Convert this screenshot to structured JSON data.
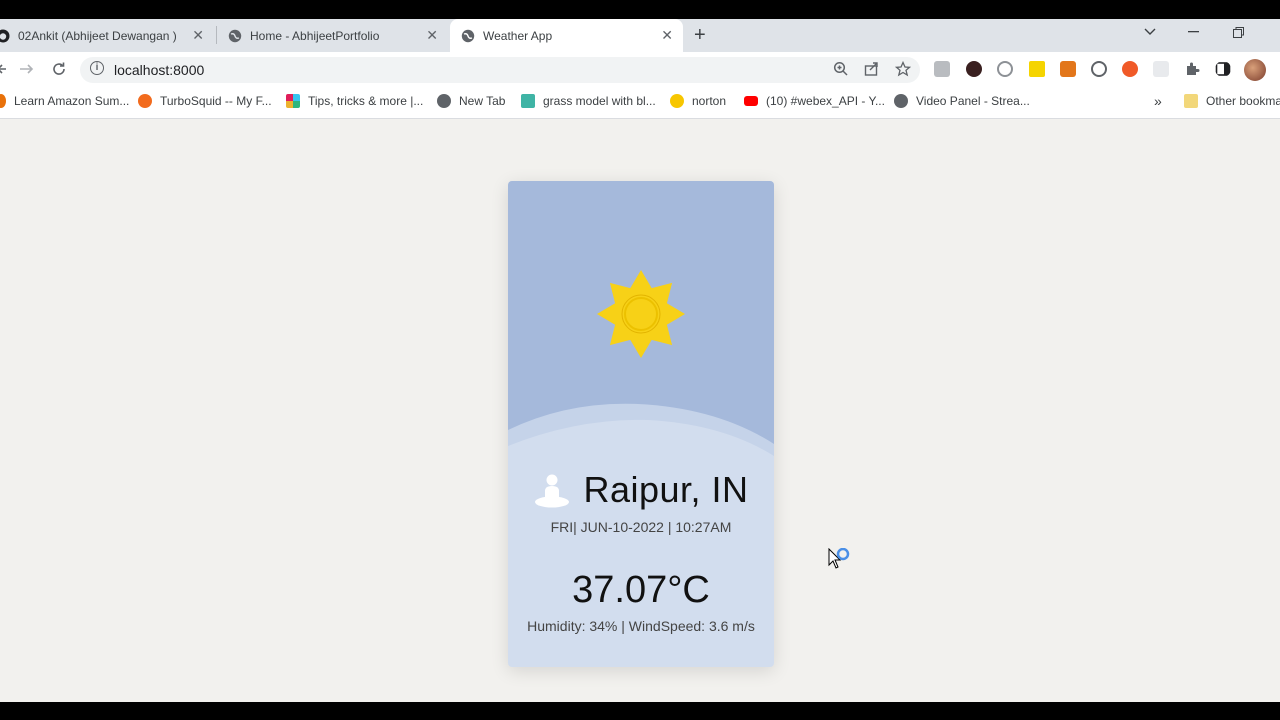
{
  "browser": {
    "tabs": [
      {
        "label": "02Ankit (Abhijeet Dewangan )",
        "icon": "github-icon",
        "active": false
      },
      {
        "label": "Home - AbhijeetPortfolio",
        "icon": "globe-icon",
        "active": false
      },
      {
        "label": "Weather App",
        "icon": "globe-icon",
        "active": true
      }
    ],
    "close_glyph": "✕",
    "new_tab_glyph": "+",
    "address": {
      "url": "localhost:8000",
      "info_glyph": "i"
    },
    "bookmarks": [
      {
        "label": "Learn Amazon Sum...",
        "icon": "amazon-icon",
        "color": "#e8710a"
      },
      {
        "label": "TurboSquid -- My F...",
        "icon": "turbosquid-icon",
        "color": "#f26b1d"
      },
      {
        "label": "Tips, tricks & more |...",
        "icon": "slack-icon",
        "color": "#611f69"
      },
      {
        "label": "New Tab",
        "icon": "globe-icon",
        "color": "#5f6368"
      },
      {
        "label": "grass model with bl...",
        "icon": "cgtrader-icon",
        "color": "#3fb4a5"
      },
      {
        "label": "norton",
        "icon": "norton-check-icon",
        "color": "#f7c600"
      },
      {
        "label": "(10) #webex_API - Y...",
        "icon": "youtube-icon",
        "color": "#ff0000"
      },
      {
        "label": "Video Panel - Strea...",
        "icon": "globe-icon",
        "color": "#5f6368"
      }
    ],
    "more_bookmarks_glyph": "»",
    "other_bookmarks": "Other bookmarks"
  },
  "weather": {
    "city": "Raipur, IN",
    "datetime": "FRI| JUN-10-2022 | 10:27AM",
    "temperature": "37.07°C",
    "details": "Humidity: 34% | WindSpeed: 3.6 m/s",
    "condition_icon": "sun-icon",
    "location_icon": "location-pin-icon"
  },
  "colors": {
    "card_top": "#a5b9db",
    "card_bottom": "#d2ddee",
    "sun": "#f7d117",
    "page_bg": "#f2f1ee"
  }
}
